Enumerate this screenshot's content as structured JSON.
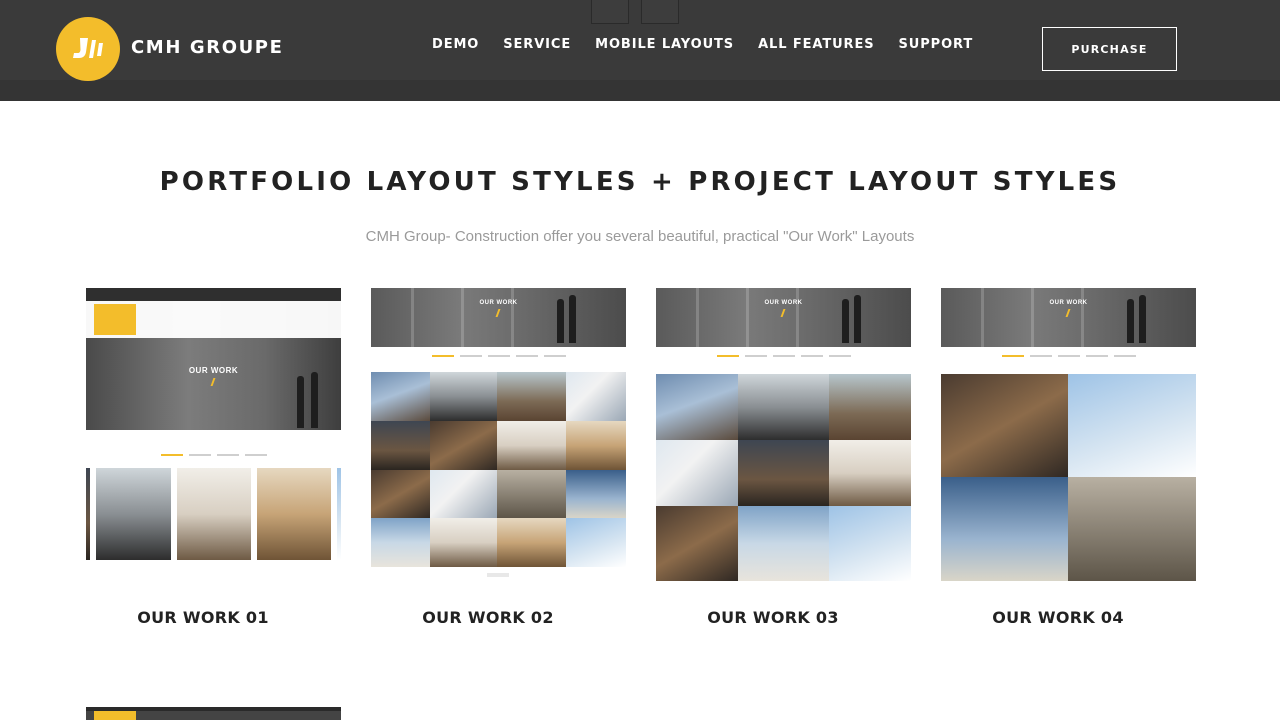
{
  "header": {
    "brand": "CMH GROUPE",
    "nav": [
      "DEMO",
      "SERVICE",
      "MOBILE LAYOUTS",
      "ALL FEATURES",
      "SUPPORT"
    ],
    "purchase_label": "PURCHASE",
    "colors": {
      "background": "#3a3a3a",
      "accent": "#f3bd2b"
    }
  },
  "section": {
    "title": "PORTFOLIO LAYOUT STYLES + PROJECT LAYOUT STYLES",
    "subtitle": "CMH Group- Construction offer you several beautiful, practical \"Our Work\" Layouts"
  },
  "cards": [
    {
      "label": "OUR WORK 01",
      "thumb_title": "OUR WORK"
    },
    {
      "label": "OUR WORK 02",
      "thumb_title": "OUR WORK"
    },
    {
      "label": "OUR WORK 03",
      "thumb_title": "OUR WORK"
    },
    {
      "label": "OUR WORK 04",
      "thumb_title": "OUR WORK"
    }
  ]
}
